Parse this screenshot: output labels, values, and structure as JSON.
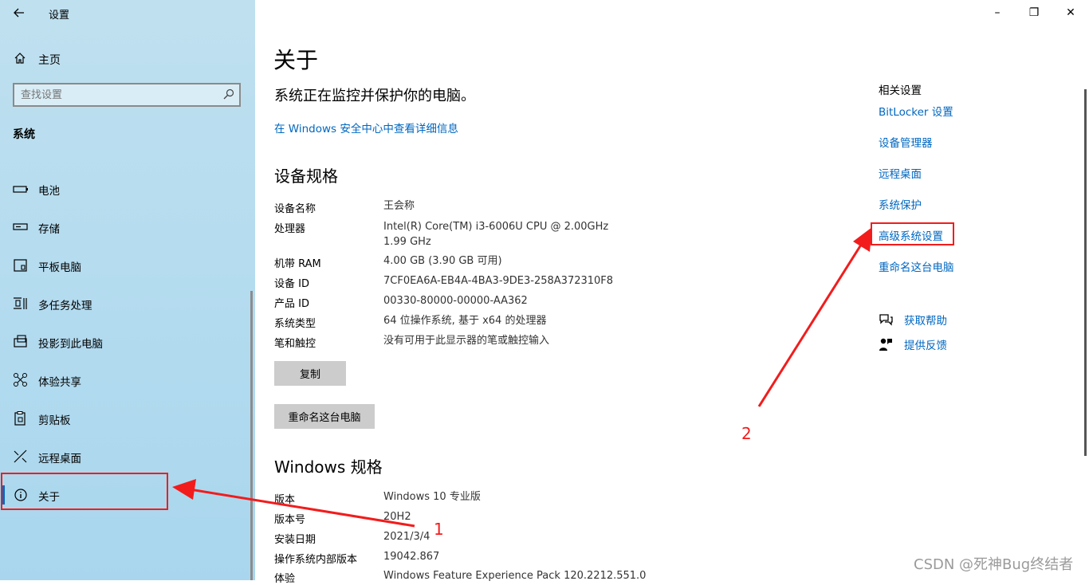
{
  "window": {
    "title": "设置",
    "controls": {
      "minimize": "–",
      "maximize": "❐",
      "close": "✕"
    }
  },
  "sidebar": {
    "home": "主页",
    "search_placeholder": "查找设置",
    "section": "系统",
    "items": [
      {
        "label": "电池",
        "icon": "battery-icon"
      },
      {
        "label": "存储",
        "icon": "storage-icon"
      },
      {
        "label": "平板电脑",
        "icon": "tablet-icon"
      },
      {
        "label": "多任务处理",
        "icon": "multitasking-icon"
      },
      {
        "label": "投影到此电脑",
        "icon": "project-icon"
      },
      {
        "label": "体验共享",
        "icon": "share-icon"
      },
      {
        "label": "剪贴板",
        "icon": "clipboard-icon"
      },
      {
        "label": "远程桌面",
        "icon": "remote-desktop-icon"
      },
      {
        "label": "关于",
        "icon": "info-icon",
        "selected": true
      }
    ]
  },
  "main": {
    "title": "关于",
    "status": "系统正在监控并保护你的电脑。",
    "security_link": "在 Windows 安全中心中查看详细信息",
    "device_specs": {
      "heading": "设备规格",
      "rows": [
        {
          "label": "设备名称",
          "value": "王会称"
        },
        {
          "label": "处理器",
          "value": "Intel(R) Core(TM) i3-6006U CPU @ 2.00GHz   1.99 GHz"
        },
        {
          "label": "机带 RAM",
          "value": "4.00 GB (3.90 GB 可用)"
        },
        {
          "label": "设备 ID",
          "value": "7CF0EA6A-EB4A-4BA3-9DE3-258A372310F8"
        },
        {
          "label": "产品 ID",
          "value": "00330-80000-00000-AA362"
        },
        {
          "label": "系统类型",
          "value": "64 位操作系统, 基于 x64 的处理器"
        },
        {
          "label": "笔和触控",
          "value": "没有可用于此显示器的笔或触控输入"
        }
      ],
      "copy_button": "复制",
      "rename_button": "重命名这台电脑"
    },
    "windows_specs": {
      "heading": "Windows 规格",
      "rows": [
        {
          "label": "版本",
          "value": "Windows 10 专业版"
        },
        {
          "label": "版本号",
          "value": "20H2"
        },
        {
          "label": "安装日期",
          "value": "2021/3/4"
        },
        {
          "label": "操作系统内部版本",
          "value": "19042.867"
        },
        {
          "label": "体验",
          "value": "Windows Feature Experience Pack 120.2212.551.0"
        }
      ]
    }
  },
  "related": {
    "title": "相关设置",
    "links": [
      "BitLocker 设置",
      "设备管理器",
      "远程桌面",
      "系统保护",
      "高级系统设置",
      "重命名这台电脑"
    ],
    "help": {
      "get_help": "获取帮助",
      "feedback": "提供反馈"
    }
  },
  "annotations": {
    "arrow1": "1",
    "arrow2": "2",
    "color": "#f21c1c"
  },
  "watermark": "CSDN @死神Bug终结者",
  "accent_color": "#0067c0"
}
